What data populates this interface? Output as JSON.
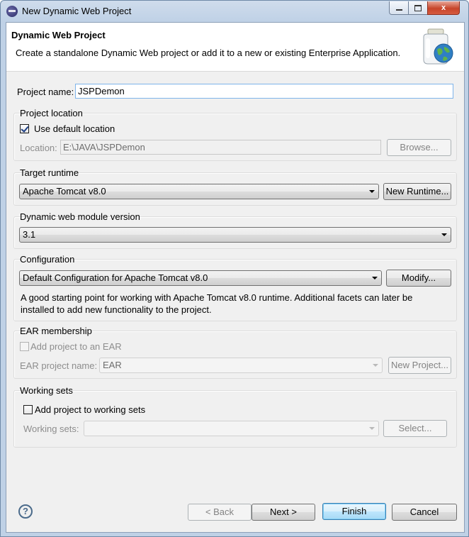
{
  "window": {
    "title": "New Dynamic Web Project",
    "controls": {
      "minimize": "",
      "maximize": "",
      "close": "x"
    }
  },
  "banner": {
    "title": "Dynamic Web Project",
    "description": "Create a standalone Dynamic Web project or add it to a new or existing Enterprise Application."
  },
  "project_name": {
    "label": "Project name:",
    "value": "JSPDemon"
  },
  "project_location": {
    "heading": "Project location",
    "use_default_label": "Use default location",
    "use_default_checked": true,
    "location_label": "Location:",
    "location_value": "E:\\JAVA\\JSPDemon",
    "browse_label": "Browse..."
  },
  "target_runtime": {
    "heading": "Target runtime",
    "selected": "Apache Tomcat v8.0",
    "new_runtime_label": "New Runtime..."
  },
  "module_version": {
    "heading": "Dynamic web module version",
    "selected": "3.1"
  },
  "configuration": {
    "heading": "Configuration",
    "selected": "Default Configuration for Apache Tomcat v8.0",
    "modify_label": "Modify...",
    "description_line1": "A good starting point for working with Apache Tomcat v8.0 runtime. Additional facets can later be",
    "description_line2": "installed to add new functionality to the project."
  },
  "ear": {
    "heading": "EAR membership",
    "add_label": "Add project to an EAR",
    "add_checked": false,
    "project_name_label": "EAR project name:",
    "project_name_value": "EAR",
    "new_project_label": "New Project..."
  },
  "working_sets": {
    "heading": "Working sets",
    "add_label": "Add project to working sets",
    "add_checked": false,
    "sets_label": "Working sets:",
    "sets_value": "",
    "select_label": "Select..."
  },
  "footer": {
    "help": "?",
    "back_label": "< Back",
    "next_label": "Next >",
    "finish_label": "Finish",
    "cancel_label": "Cancel"
  }
}
